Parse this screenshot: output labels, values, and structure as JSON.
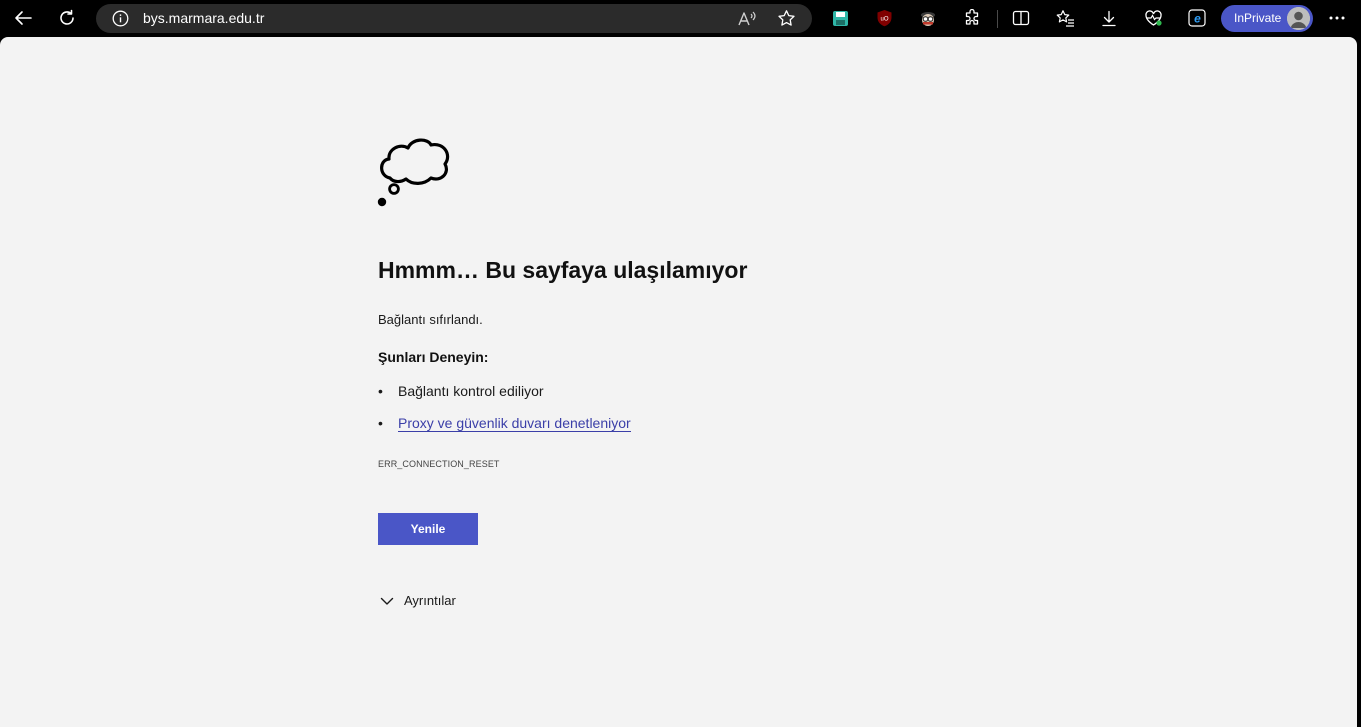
{
  "browser": {
    "url": "bys.marmara.edu.tr",
    "inprivate_label": "InPrivate",
    "icons": {
      "back": "back-arrow-icon",
      "refresh": "refresh-icon",
      "site_info": "info-icon",
      "read_aloud": "read-aloud-icon",
      "favorite": "star-icon",
      "ext1": "save-extension-icon",
      "ext2": "ublock-origin-icon",
      "ext3": "spy-extension-icon",
      "extensions": "puzzle-icon",
      "split": "split-screen-icon",
      "favorites": "favorites-list-icon",
      "downloads": "download-icon",
      "health": "browser-essentials-icon",
      "ie_mode": "ie-mode-icon",
      "menu": "more-dots-icon"
    },
    "accent": "#4a56c7"
  },
  "error": {
    "title": "Hmmm… Bu sayfaya ulaşılamıyor",
    "description": "Bağlantı sıfırlandı.",
    "try_heading": "Şunları Deneyin:",
    "suggestions": [
      "Bağlantı kontrol ediliyor",
      "Proxy ve güvenlik duvarı denetleniyor"
    ],
    "bullet": "•",
    "code": "ERR_CONNECTION_RESET",
    "reload_label": "Yenile",
    "details_label": "Ayrıntılar"
  }
}
